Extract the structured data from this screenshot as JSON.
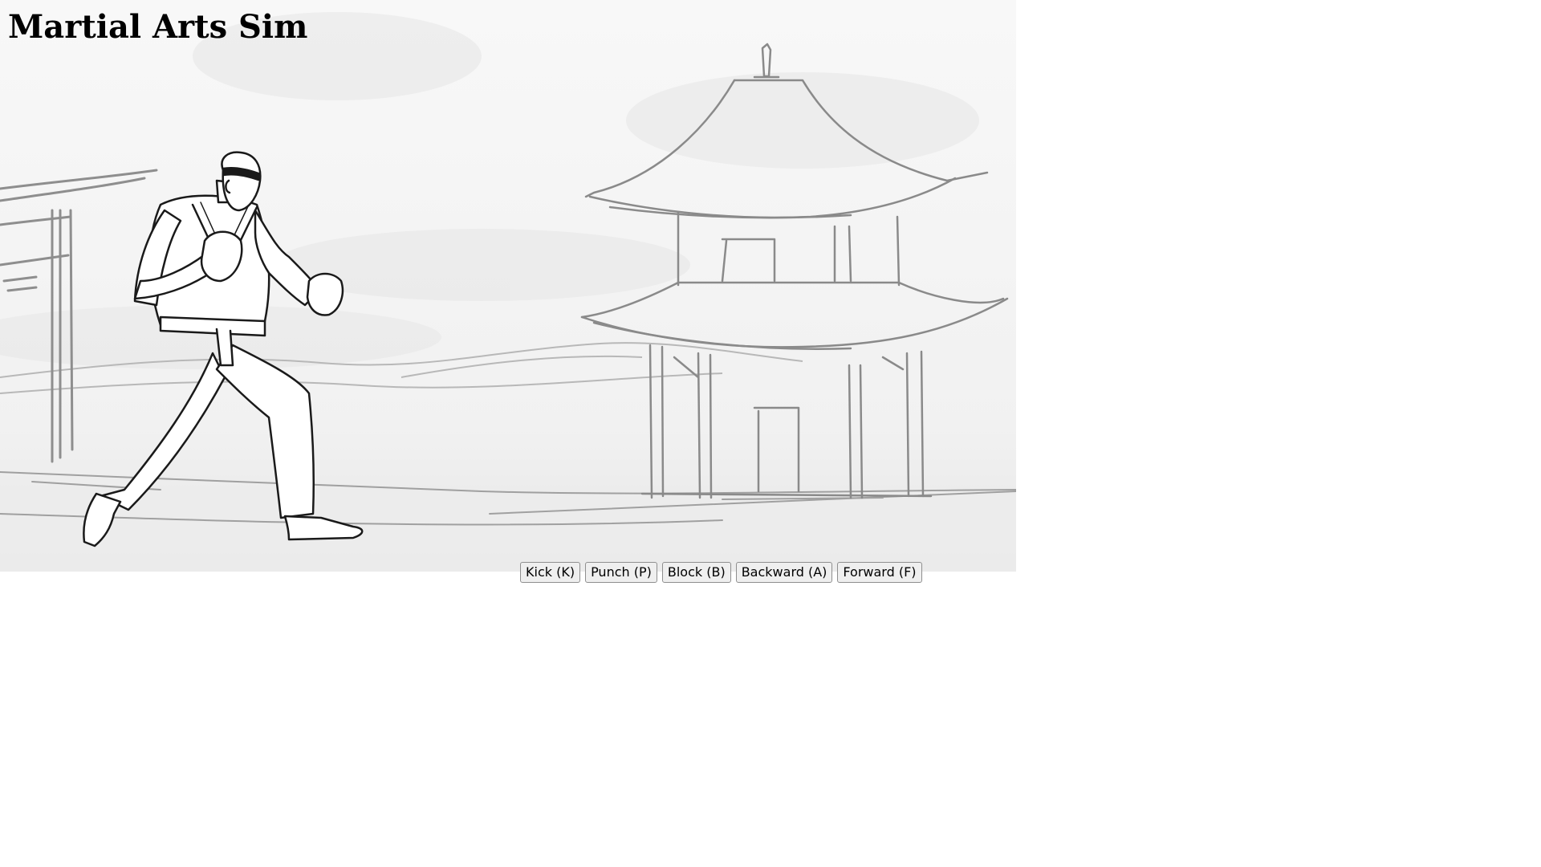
{
  "title": "Martial Arts Sim",
  "controls": {
    "kick": "Kick (K)",
    "punch": "Punch (P)",
    "block": "Block (B)",
    "backward": "Backward (A)",
    "forward": "Forward (F)"
  },
  "scene": {
    "background": "pencil-sketch-dojo",
    "fighter_pose": "fighting-stance",
    "colors": {
      "sky": "#f6f6f6",
      "ground": "#e9e9e9",
      "ink": "#1a1a1a",
      "sketch": "#9a9a9a"
    }
  }
}
